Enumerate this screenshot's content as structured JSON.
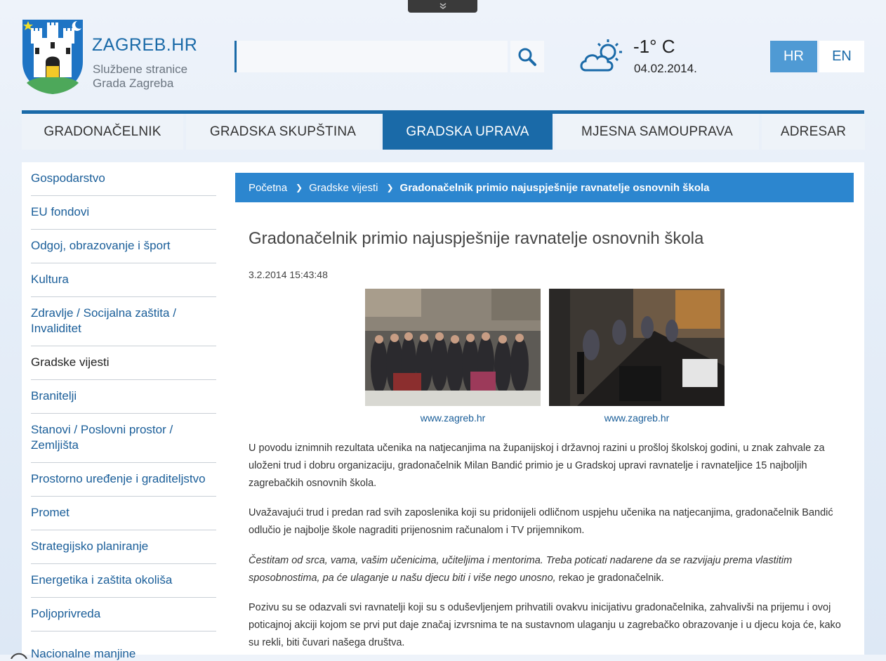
{
  "header": {
    "site_name": "ZAGREB.HR",
    "site_sub_1": "Službene stranice",
    "site_sub_2": "Grada Zagreba",
    "search_value": "",
    "weather": {
      "temperature": "-1° C",
      "date": "04.02.2014."
    },
    "languages": {
      "hr": "HR",
      "en": "EN",
      "active": "HR"
    }
  },
  "nav": {
    "items": [
      {
        "label": "GRADONAČELNIK"
      },
      {
        "label": "GRADSKA SKUPŠTINA"
      },
      {
        "label": "GRADSKA UPRAVA"
      },
      {
        "label": "MJESNA SAMOUPRAVA"
      },
      {
        "label": "ADRESAR"
      }
    ],
    "active": "GRADSKA UPRAVA"
  },
  "sidebar": {
    "items": [
      {
        "label": "Gospodarstvo"
      },
      {
        "label": "EU fondovi"
      },
      {
        "label": "Odgoj, obrazovanje i šport"
      },
      {
        "label": "Kultura"
      },
      {
        "label": "Zdravlje / Socijalna zaštita / Invaliditet"
      },
      {
        "label": "Gradske vijesti"
      },
      {
        "label": "Branitelji"
      },
      {
        "label": "Stanovi / Poslovni prostor / Zemljišta"
      },
      {
        "label": "Prostorno uređenje i graditeljstvo"
      },
      {
        "label": "Promet"
      },
      {
        "label": "Strategijsko planiranje"
      },
      {
        "label": "Energetika i zaštita okoliša"
      },
      {
        "label": "Poljoprivreda"
      }
    ],
    "current": "Gradske vijesti",
    "cut_item": "Nacionalne manjine"
  },
  "breadcrumb": {
    "home": "Početna",
    "section": "Gradske vijesti",
    "current": "Gradonačelnik primio najuspješnije ravnatelje osnovnih škola"
  },
  "article": {
    "title": "Gradonačelnik primio najuspješnije ravnatelje osnovnih škola",
    "timestamp": "3.2.2014 15:43:48",
    "photos": [
      {
        "caption": "www.zagreb.hr"
      },
      {
        "caption": "www.zagreb.hr"
      }
    ],
    "paragraphs": {
      "p1": "U povodu iznimnih rezultata učenika na natjecanjima na županijskoj i državnoj razini u prošloj školskoj godini, u znak zahvale za uloženi trud i dobru organizaciju, gradonačelnik Milan Bandić primio je u Gradskoj upravi ravnatelje i ravnateljice 15 najboljih zagrebačkih osnovnih škola.",
      "p2": "Uvažavajući trud i predan rad svih zaposlenika koji su pridonijeli odličnom uspjehu učenika na natjecanjima, gradonačelnik Bandić odlučio je najbolje škole nagraditi prijenosnim računalom i TV prijemnikom.",
      "p3_italic": "Čestitam od srca, vama, vašim učenicima, učiteljima i mentorima. Treba poticati nadarene da se razvijaju prema vlastitim sposobnostima, pa će ulaganje u našu djecu biti i više nego unosno,",
      "p3_rest": " rekao je gradonačelnik.",
      "p4": "Pozivu su se odazvali svi ravnatelji koji su s oduševljenjem prihvatili ovakvu inicijativu gradonačelnika, zahvalivši na prijemu i ovoj poticajnoj akciji kojom se prvi put daje značaj izvrsnima te na sustavnom ulaganju u zagrebačko obrazovanje i u djecu koja će, kako su rekli, biti čuvari našega društva."
    }
  },
  "colors": {
    "brand_blue": "#1a6aa8",
    "breadcrumb_blue": "#2c86cf",
    "lang_active": "#4f9ad4"
  }
}
